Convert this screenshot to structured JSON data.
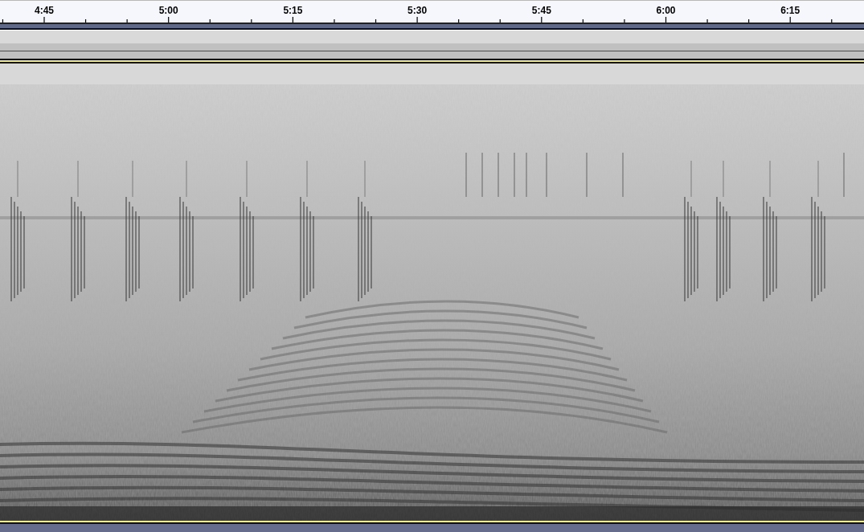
{
  "ruler": {
    "labels": [
      "4:45",
      "5:00",
      "5:15",
      "5:30",
      "5:45",
      "6:00",
      "6:15"
    ]
  }
}
